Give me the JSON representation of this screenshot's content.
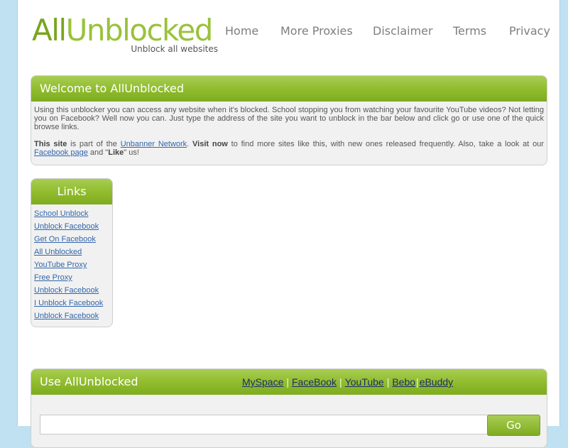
{
  "logo": {
    "part1": "All",
    "part2": "Unblocked",
    "tagline": "Unblock all websites"
  },
  "nav": [
    "Home",
    "More Proxies",
    "Disclaimer",
    "Terms",
    "Privacy"
  ],
  "welcome": {
    "title": "Welcome to AllUnblocked",
    "paragraph1": "Using this unblocker you can access any website when it's blocked. School stopping you from watching your favourite YouTube videos? Not letting you on Facebook? Well now you can. Just type the address of the site you want to unblock in the bar below and click go or use one of the quick browse links.",
    "p2_this_site": "This site",
    "p2_part_of": " is part of the ",
    "p2_network_link": "Unbanner Network",
    "p2_dot": ". ",
    "p2_visit_now": "Visit now",
    "p2_rest": " to find more sites like this, with new ones released frequently. Also, take a look at our ",
    "p2_facebook_link": "Facebook page",
    "p2_and": " and \"",
    "p2_like": "Like",
    "p2_us": "\" us!"
  },
  "links": {
    "title": "Links",
    "items": [
      "School Unblock",
      "Unblock Facebook",
      "Get On Facebook",
      "All Unblocked",
      "YouTube Proxy",
      "Free Proxy",
      "Unblock Facebook",
      "I Unblock Facebook",
      "Unblock Facebook"
    ]
  },
  "use": {
    "title": "Use AllUnblocked",
    "quick_links": [
      "MySpace",
      "FaceBook",
      "YouTube",
      "Bebo",
      "eBuddy"
    ],
    "separator": "|",
    "url_value": "",
    "go_label": "Go"
  },
  "colors": {
    "background": "#bfe1f2",
    "accent_green": "#8fbb2c",
    "link_blue": "#3366aa"
  }
}
